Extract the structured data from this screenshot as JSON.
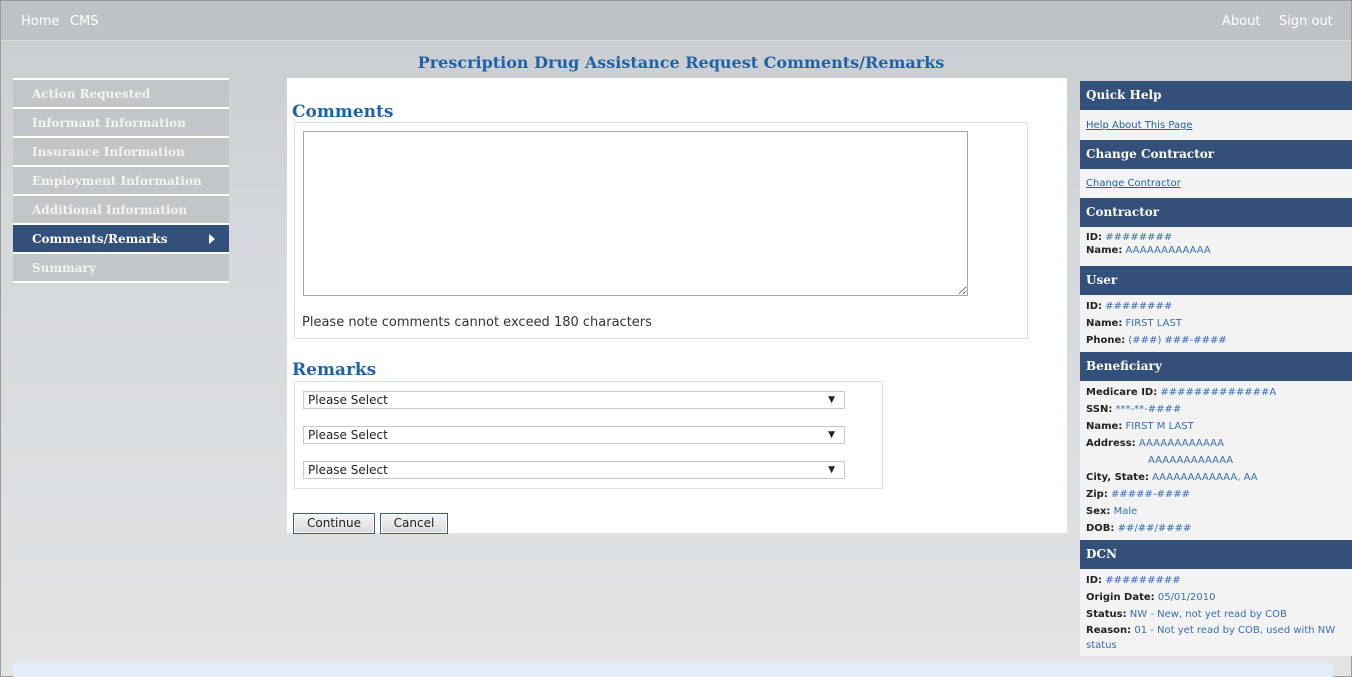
{
  "topnav": {
    "home": "Home",
    "cms": "CMS",
    "about": "About",
    "signout": "Sign out"
  },
  "page_title": "Prescription Drug Assistance Request Comments/Remarks",
  "leftnav": [
    {
      "label": "Action Requested"
    },
    {
      "label": "Informant Information"
    },
    {
      "label": "Insurance Information"
    },
    {
      "label": "Employment Information"
    },
    {
      "label": "Additional Information"
    },
    {
      "label": "Comments/Remarks",
      "active": true
    },
    {
      "label": "Summary"
    }
  ],
  "comments": {
    "title": "Comments",
    "value": "",
    "note": "Please note comments cannot exceed 180 characters"
  },
  "remarks": {
    "title": "Remarks",
    "selects": [
      "Please Select",
      "Please Select",
      "Please Select"
    ]
  },
  "buttons": {
    "continue": "Continue",
    "cancel": "Cancel"
  },
  "right": {
    "quick_help": {
      "title": "Quick Help",
      "link": "Help About This Page"
    },
    "change_contractor": {
      "title": "Change Contractor",
      "link": "Change Contractor"
    },
    "contractor": {
      "title": "Contractor",
      "id_label": "ID:",
      "id": "########",
      "name_label": "Name:",
      "name": "AAAAAAAAAAAA"
    },
    "user": {
      "title": "User",
      "id_label": "ID:",
      "id": "########",
      "name_label": "Name:",
      "name": "FIRST LAST",
      "phone_label": "Phone:",
      "phone": "(###) ###-####"
    },
    "beneficiary": {
      "title": "Beneficiary",
      "medicare_label": "Medicare ID:",
      "medicare": "#############A",
      "ssn_label": "SSN:",
      "ssn": "***-**-####",
      "name_label": "Name:",
      "name": "FIRST M LAST",
      "address_label": "Address:",
      "address1": "AAAAAAAAAAAA",
      "address2": "AAAAAAAAAAAA",
      "city_label": "City, State:",
      "city": "AAAAAAAAAAAA, AA",
      "zip_label": "Zip:",
      "zip": "#####-####",
      "sex_label": "Sex:",
      "sex": "Male",
      "dob_label": "DOB:",
      "dob": "##/##/####"
    },
    "dcn": {
      "title": "DCN",
      "id_label": "ID:",
      "id": "#########",
      "origin_label": "Origin Date:",
      "origin": "05/01/2010",
      "status_label": "Status:",
      "status": "NW - New, not yet read by COB",
      "reason_label": "Reason:",
      "reason": "01 - Not yet read by COB, used with NW status"
    }
  }
}
